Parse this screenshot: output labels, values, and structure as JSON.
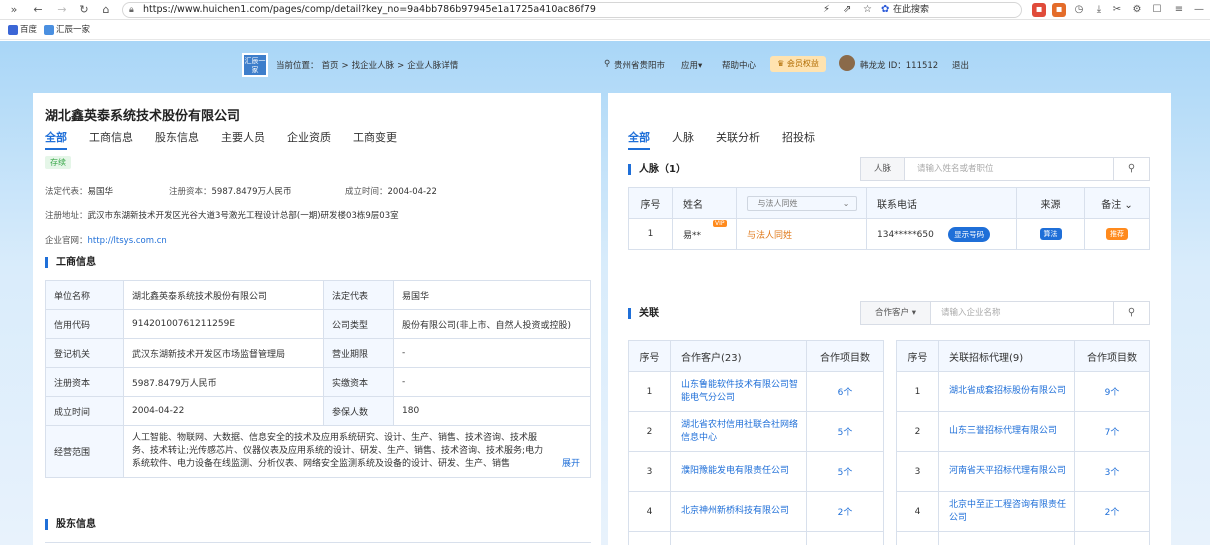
{
  "browser": {
    "url": "https://www.huichen1.com/pages/comp/detail?key_no=9a4bb786b97945e1a1725a410ac86f79",
    "search_label": "在此搜索",
    "bookmarks": [
      "百度",
      "汇辰一家"
    ]
  },
  "topnav": {
    "logo_text": "汇辰一家",
    "breadcrumb_prefix": "当前位置：",
    "breadcrumb": [
      "首页",
      ">",
      "找企业人脉",
      ">",
      "企业人脉详情"
    ],
    "location": "贵州省贵阳市",
    "apps": "应用",
    "help": "帮助中心",
    "vip_rights": "会员权益",
    "user": "韩龙龙 ID：111512",
    "logout": "退出"
  },
  "company": {
    "name": "湖北鑫英泰系统技术股份有限公司",
    "tabs": [
      "全部",
      "工商信息",
      "股东信息",
      "主要人员",
      "企业资质",
      "工商变更"
    ],
    "status": "存续",
    "legal_rep_label": "法定代表：",
    "legal_rep": "易国华",
    "capital_label": "注册资本：",
    "capital": "5987.8479万人民币",
    "founded_label": "成立时间：",
    "founded": "2004-04-22",
    "address_label": "注册地址：",
    "address": "武汉市东湖新技术开发区光谷大道3号激光工程设计总部(一期)研发楼03栋9层03室",
    "website_label": "企业官网：",
    "website": "http://ltsys.com.cn"
  },
  "gongshang": {
    "title": "工商信息",
    "rows": [
      [
        "单位名称",
        "湖北鑫英泰系统技术股份有限公司",
        "法定代表",
        "易国华"
      ],
      [
        "信用代码",
        "91420100761211259E",
        "公司类型",
        "股份有限公司(非上市、自然人投资或控股)"
      ],
      [
        "登记机关",
        "武汉东湖新技术开发区市场监督管理局",
        "营业期限",
        "-"
      ],
      [
        "注册资本",
        "5987.8479万人民币",
        "实缴资本",
        "-"
      ],
      [
        "成立时间",
        "2004-04-22",
        "参保人数",
        "180"
      ]
    ],
    "scope_label": "经营范围",
    "scope": "人工智能、物联网、大数据、信息安全的技术及应用系统研究、设计、生产、销售、技术咨询、技术服务、技术转让;光传感芯片、仪器仪表及应用系统的设计、研发、生产、销售、技术咨询、技术服务;电力系统软件、电力设备在线监测、分析仪表、网络安全监测系统及设备的设计、研发、生产、销售",
    "expand": "展开"
  },
  "shareholder_title": "股东信息",
  "right": {
    "tabs": [
      "全部",
      "人脉",
      "关联分析",
      "招投标"
    ],
    "renmai_title": "人脉（1）",
    "renmai_search_label": "人脉",
    "renmai_search_placeholder": "请输入姓名或者职位",
    "renmai_headers": [
      "序号",
      "姓名",
      "与法人同姓",
      "联系电话",
      "来源",
      "备注"
    ],
    "renmai_rows": [
      {
        "no": "1",
        "name": "易**",
        "vip": "VIP",
        "relation": "与法人同姓",
        "phone": "134*****650",
        "show_btn": "显示号码",
        "source": "算法",
        "note": "推荐"
      }
    ],
    "guanlian_title": "关联",
    "guanlian_select": "合作客户",
    "guanlian_placeholder": "请输入企业名称",
    "clients_headers": [
      "序号",
      "合作客户(23)",
      "合作项目数"
    ],
    "clients": [
      [
        "1",
        "山东鲁能软件技术有限公司智能电气分公司",
        "6个"
      ],
      [
        "2",
        "湖北省农村信用社联合社网络信息中心",
        "5个"
      ],
      [
        "3",
        "濮阳豫能发电有限责任公司",
        "5个"
      ],
      [
        "4",
        "北京神州新桥科技有限公司",
        "2个"
      ],
      [
        "5",
        "新乡中益发电有限公司",
        "2个"
      ]
    ],
    "agents_headers": [
      "序号",
      "关联招标代理(9)",
      "合作项目数"
    ],
    "agents": [
      [
        "1",
        "湖北省成套招标股份有限公司",
        "9个"
      ],
      [
        "2",
        "山东三誉招标代理有限公司",
        "7个"
      ],
      [
        "3",
        "河南省天平招标代理有限公司",
        "3个"
      ],
      [
        "4",
        "北京中至正工程咨询有限责任公司",
        "2个"
      ],
      [
        "5",
        "新乡中益发电有限公司",
        "1个"
      ]
    ]
  }
}
